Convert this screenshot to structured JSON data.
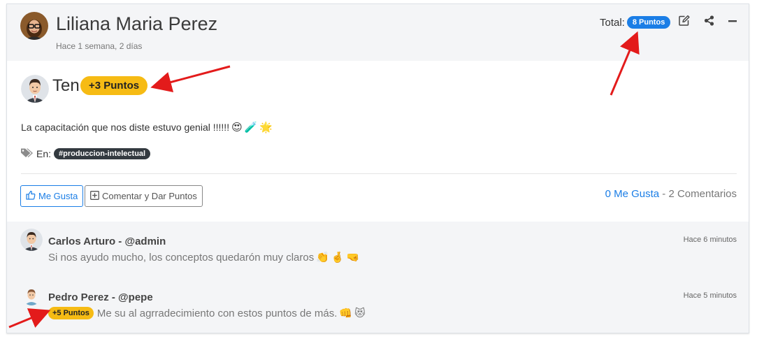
{
  "post": {
    "author_name": "Liliana Maria Perez",
    "posted_ago": "Hace 1 semana, 2 días",
    "total_label": "Total:",
    "total_points": "8 Puntos",
    "recipient_prefix": "Ten",
    "points_given": "+3 Puntos",
    "message": "La capacitación que nos diste estuvo genial !!!!!!",
    "message_emojis": [
      "😍",
      "🧪",
      "🌟"
    ],
    "tags_label": "En:",
    "tag": "#produccion-intelectual",
    "like_button": "Me Gusta",
    "comment_button": "Comentar y Dar Puntos",
    "likes_link": "0 Me Gusta",
    "separator": " - ",
    "comments_count": "2 Comentarios"
  },
  "header_icons": [
    "edit-icon",
    "share-icon",
    "minimize-icon"
  ],
  "comments": [
    {
      "name": "Carlos Arturo - @admin",
      "time": "Hace 6 minutos",
      "points": "",
      "text": "Si nos ayudo mucho, los conceptos quedarón muy claros",
      "emojis": [
        "👏",
        "🤞",
        "🤜"
      ]
    },
    {
      "name": "Pedro Perez - @pepe",
      "time": "Hace 5 minutos",
      "points": "+5 Puntos",
      "text": "Me su al agrradecimiento con estos puntos de más.",
      "emojis": [
        "👊",
        "😻"
      ]
    }
  ],
  "colors": {
    "accent_blue": "#1b7ee6",
    "points_yellow": "#f6bb14",
    "annotation_red": "#e31b1b",
    "header_bg": "#f4f5f7",
    "tag_dark": "#333a40"
  }
}
